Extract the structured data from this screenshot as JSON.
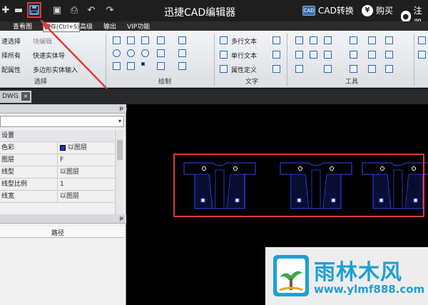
{
  "title_bar": {
    "app_title": "迅捷CAD编辑器",
    "cad_convert": "CAD转换",
    "buy": "购买",
    "register": "注册",
    "cad_badge": "CAD",
    "yen": "¥"
  },
  "menu": {
    "view": "查看图",
    "tools": "高级",
    "output": "输出",
    "vip": "VIP功能"
  },
  "tooltip": "保存(Ctrl+S)",
  "ribbon": {
    "select_group": "选择",
    "draw_group": "绘制",
    "text_group": "文字",
    "tools_group": "工具",
    "quick_select": "速选择",
    "select_all": "择所有",
    "match_props": "配属性",
    "block_edit": "块编辑",
    "quick_entity": "快速实体导",
    "polygon_entity": "多边形实体输入",
    "mtext": "多行文本",
    "stext": "单行文本",
    "attr_def": "属性定义"
  },
  "tab": {
    "doc_name": "DWG",
    "close_glyph": "×"
  },
  "properties": {
    "pin_glyph": "ᵽ",
    "combo_arrow": "▾",
    "rows": [
      {
        "key": "设置",
        "value": ""
      },
      {
        "key": "色彩",
        "value": "以图层"
      },
      {
        "key": "图层",
        "value": "F"
      },
      {
        "key": "线型",
        "value": "以图层"
      },
      {
        "key": "线型比例",
        "value": "1"
      },
      {
        "key": "线宽",
        "value": "以图层"
      }
    ],
    "path_header": "路径"
  },
  "watermark": {
    "title": "雨林木风",
    "url": "www.ylmf888.com"
  },
  "colors": {
    "drawing_blue": "#3344ff",
    "highlight_red": "#e03a3a",
    "watermark_blue": "#1e9fd6"
  }
}
